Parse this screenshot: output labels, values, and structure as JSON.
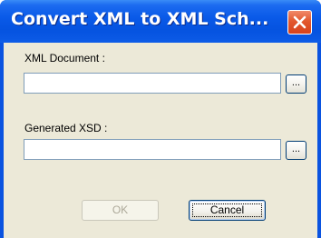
{
  "window": {
    "title": "Convert XML to XML Sch..."
  },
  "form": {
    "xml_document_label": "XML Document :",
    "xml_document_value": "",
    "generated_xsd_label": "Generated XSD :",
    "generated_xsd_value": "",
    "browse_label": "..."
  },
  "buttons": {
    "ok_label": "OK",
    "ok_enabled": false,
    "cancel_label": "Cancel"
  },
  "colors": {
    "titlebar": "#0553e0",
    "close_button": "#e2582e",
    "dialog_face": "#ece9d8",
    "input_border": "#7f9db9",
    "button_border": "#003c74",
    "disabled_text": "#aca899"
  },
  "icons": {
    "close": "close-x-icon"
  }
}
